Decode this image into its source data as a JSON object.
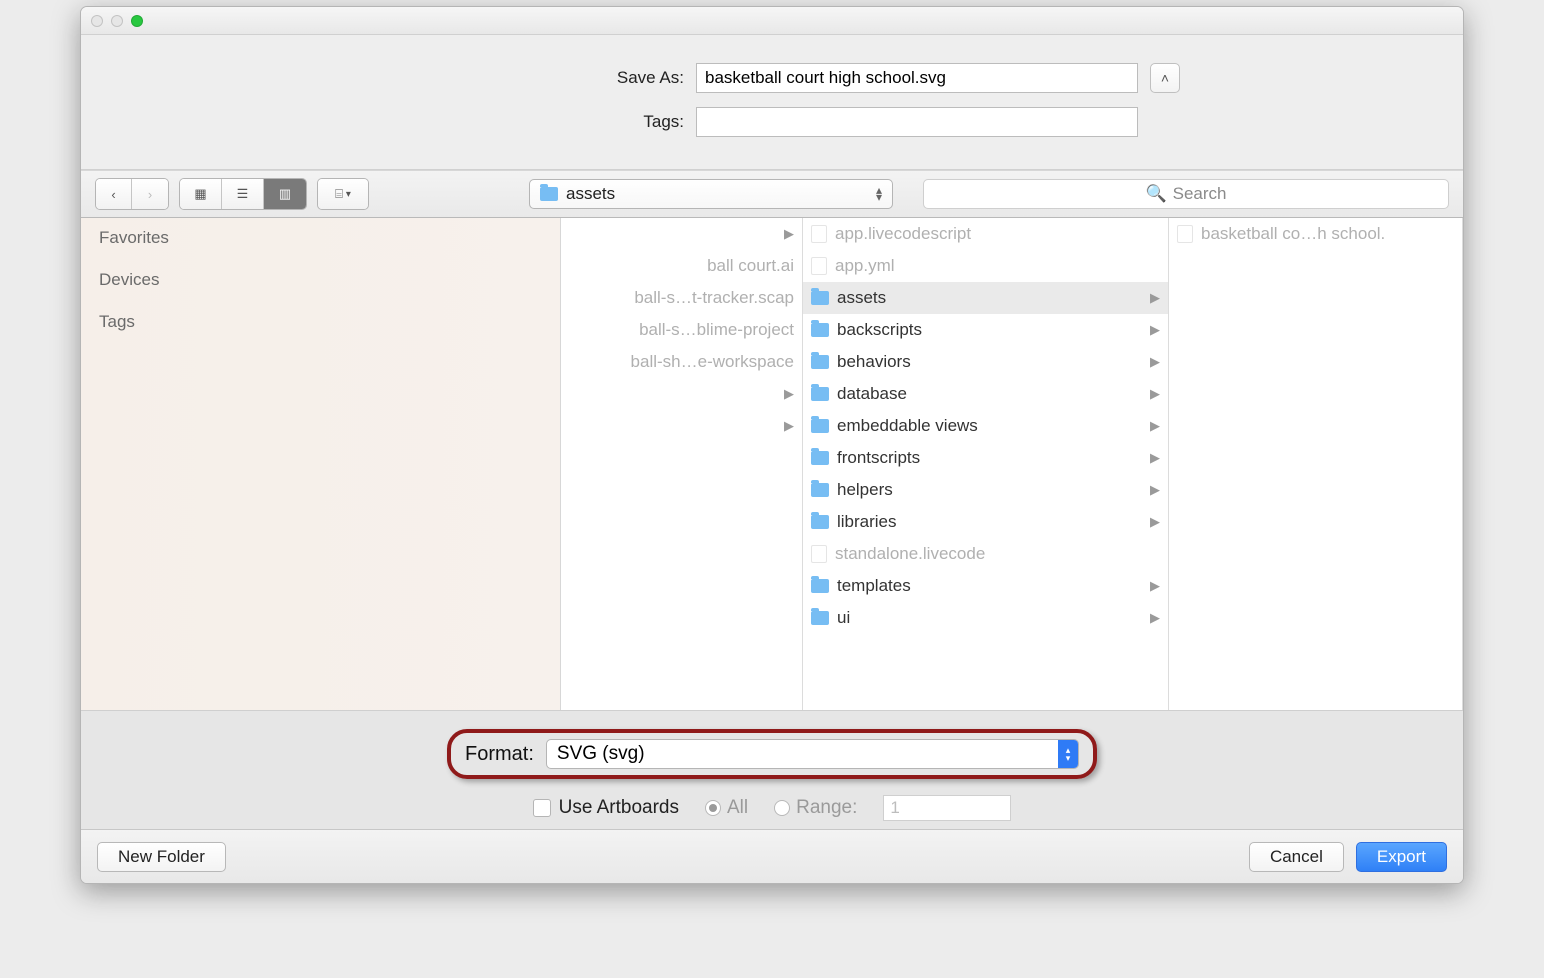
{
  "form": {
    "save_as_label": "Save As:",
    "save_as_value": "basketball court high school.svg",
    "tags_label": "Tags:",
    "tags_value": ""
  },
  "toolbar": {
    "folder_name": "assets",
    "search_placeholder": "Search"
  },
  "sidebar": {
    "favorites": "Favorites",
    "devices": "Devices",
    "tags": "Tags"
  },
  "col1": [
    {
      "txt": "",
      "arrow": true
    },
    {
      "txt": "ball court.ai",
      "arrow": false
    },
    {
      "txt": "ball-s…t-tracker.scap",
      "arrow": false
    },
    {
      "txt": "ball-s…blime-project",
      "arrow": false
    },
    {
      "txt": "ball-sh…e-workspace",
      "arrow": false
    },
    {
      "txt": "",
      "arrow": true
    },
    {
      "txt": "",
      "arrow": true
    }
  ],
  "col2": [
    {
      "icon": "file",
      "txt": "app.livecodescript",
      "dim": true,
      "arrow": false,
      "sel": false
    },
    {
      "icon": "file",
      "txt": "app.yml",
      "dim": true,
      "arrow": false,
      "sel": false
    },
    {
      "icon": "folder",
      "txt": "assets",
      "dim": false,
      "arrow": true,
      "sel": true
    },
    {
      "icon": "folder",
      "txt": "backscripts",
      "dim": false,
      "arrow": true,
      "sel": false
    },
    {
      "icon": "folder",
      "txt": "behaviors",
      "dim": false,
      "arrow": true,
      "sel": false
    },
    {
      "icon": "folder",
      "txt": "database",
      "dim": false,
      "arrow": true,
      "sel": false
    },
    {
      "icon": "folder",
      "txt": "embeddable views",
      "dim": false,
      "arrow": true,
      "sel": false
    },
    {
      "icon": "folder",
      "txt": "frontscripts",
      "dim": false,
      "arrow": true,
      "sel": false
    },
    {
      "icon": "folder",
      "txt": "helpers",
      "dim": false,
      "arrow": true,
      "sel": false
    },
    {
      "icon": "folder",
      "txt": "libraries",
      "dim": false,
      "arrow": true,
      "sel": false
    },
    {
      "icon": "file",
      "txt": "standalone.livecode",
      "dim": true,
      "arrow": false,
      "sel": false
    },
    {
      "icon": "folder",
      "txt": "templates",
      "dim": false,
      "arrow": true,
      "sel": false
    },
    {
      "icon": "folder",
      "txt": "ui",
      "dim": false,
      "arrow": true,
      "sel": false
    }
  ],
  "col3": [
    {
      "txt": "basketball co…h school."
    }
  ],
  "format": {
    "label": "Format:",
    "value": "SVG (svg)",
    "use_artboards": "Use Artboards",
    "all": "All",
    "range": "Range:",
    "range_value": "1"
  },
  "buttons": {
    "new_folder": "New Folder",
    "cancel": "Cancel",
    "export": "Export"
  }
}
